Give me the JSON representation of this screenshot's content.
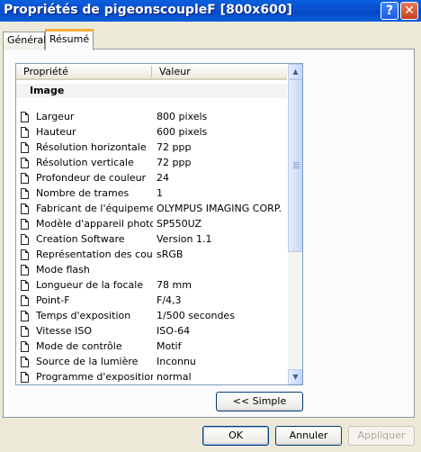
{
  "window": {
    "title": "Propriétés de pigeonscoupleF [800x600]",
    "help_label": "?",
    "close_label": "✕"
  },
  "tabs": [
    {
      "label": "Général",
      "active": false
    },
    {
      "label": "Résumé",
      "active": true
    }
  ],
  "list": {
    "headers": {
      "property": "Propriété",
      "value": "Valeur"
    },
    "group": "Image",
    "rows": [
      {
        "name": "Largeur",
        "value": "800 pixels"
      },
      {
        "name": "Hauteur",
        "value": "600 pixels"
      },
      {
        "name": "Résolution horizontale",
        "value": "72 ppp"
      },
      {
        "name": "Résolution verticale",
        "value": "72 ppp"
      },
      {
        "name": "Profondeur de couleur",
        "value": "24"
      },
      {
        "name": "Nombre de trames",
        "value": "1"
      },
      {
        "name": "Fabricant de l'équipement",
        "value": "OLYMPUS IMAGING CORP."
      },
      {
        "name": "Modèle d'appareil photo",
        "value": "SP550UZ"
      },
      {
        "name": "Creation Software",
        "value": "Version 1.1"
      },
      {
        "name": "Représentation des cou...",
        "value": "sRGB"
      },
      {
        "name": "Mode flash",
        "value": ""
      },
      {
        "name": "Longueur de la focale",
        "value": "78 mm"
      },
      {
        "name": "Point-F",
        "value": "F/4,3"
      },
      {
        "name": "Temps d'exposition",
        "value": "1/500 secondes"
      },
      {
        "name": "Vitesse ISO",
        "value": "ISO-64"
      },
      {
        "name": "Mode de contrôle",
        "value": "Motif"
      },
      {
        "name": "Source de la lumière",
        "value": "Inconnu"
      },
      {
        "name": "Programme d'exposition",
        "value": "normal"
      }
    ]
  },
  "buttons": {
    "simple": "<< Simple",
    "ok": "OK",
    "cancel": "Annuler",
    "apply": "Appliquer"
  },
  "icons": {
    "row_icon": "document-icon",
    "scroll_up": "▲",
    "scroll_down": "▼"
  }
}
